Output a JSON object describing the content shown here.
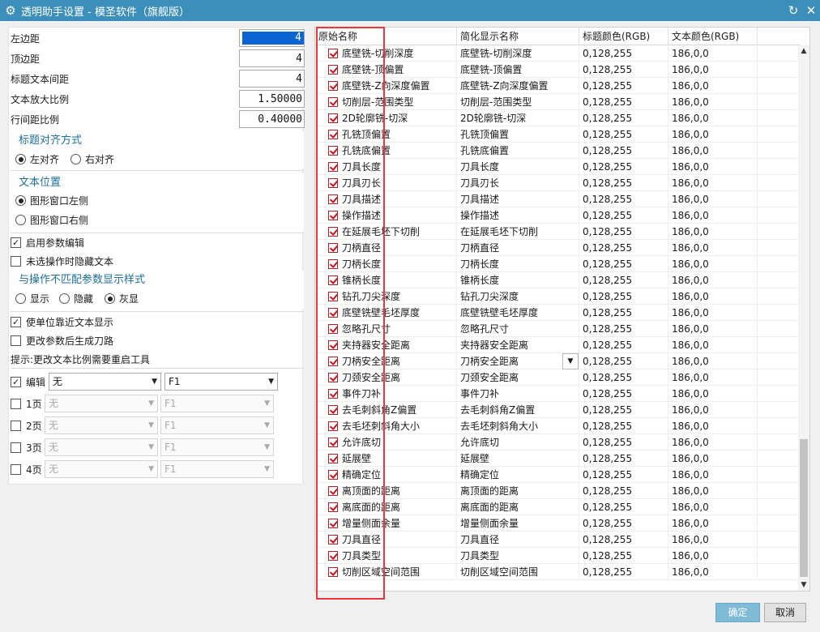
{
  "window": {
    "title": "透明助手设置 - 模圣软件（旗舰版）",
    "icon": "gear-icon"
  },
  "params": {
    "left_margin": {
      "label": "左边距",
      "value": "4"
    },
    "top_margin": {
      "label": "顶边距",
      "value": "4"
    },
    "title_text_spacing": {
      "label": "标题文本间距",
      "value": "4"
    },
    "text_scale": {
      "label": "文本放大比例",
      "value": "1.50000"
    },
    "line_spacing": {
      "label": "行间距比例",
      "value": "0.40000"
    }
  },
  "title_align": {
    "title": "标题对齐方式",
    "options": [
      "左对齐",
      "右对齐"
    ],
    "selected": "左对齐"
  },
  "text_position": {
    "title": "文本位置",
    "options": [
      "图形窗口左侧",
      "图形窗口右侧"
    ],
    "selected": "图形窗口左侧"
  },
  "checks": {
    "enable_param_edit": {
      "label": "启用参数编辑",
      "checked": true
    },
    "hide_text_unselected": {
      "label": "未选操作时隐藏文本",
      "checked": false
    },
    "unit_near_text": {
      "label": "使单位靠近文本显示",
      "checked": true
    },
    "regen_path_after_change": {
      "label": "更改参数后生成刀路",
      "checked": false
    }
  },
  "mismatch_style": {
    "title": "与操作不匹配参数显示样式",
    "options": [
      "显示",
      "隐藏",
      "灰显"
    ],
    "selected": "灰显"
  },
  "hint": "提示:更改文本比例需要重启工具",
  "pages": [
    {
      "label": "编辑",
      "checked": true,
      "opt1": "无",
      "opt2": "F1",
      "enabled": true
    },
    {
      "label": "1页",
      "checked": false,
      "opt1": "无",
      "opt2": "F1",
      "enabled": false
    },
    {
      "label": "2页",
      "checked": false,
      "opt1": "无",
      "opt2": "F1",
      "enabled": false
    },
    {
      "label": "3页",
      "checked": false,
      "opt1": "无",
      "opt2": "F1",
      "enabled": false
    },
    {
      "label": "4页",
      "checked": false,
      "opt1": "无",
      "opt2": "F1",
      "enabled": false
    }
  ],
  "table": {
    "headers": [
      "原始名称",
      "简化显示名称",
      "标题颜色(RGB)",
      "文本颜色(RGB)"
    ],
    "rows": [
      {
        "name": "底壁铣-切削深度",
        "short": "底壁铣-切削深度",
        "title_rgb": "0,128,255",
        "text_rgb": "186,0,0"
      },
      {
        "name": "底壁铣-顶偏置",
        "short": "底壁铣-顶偏置",
        "title_rgb": "0,128,255",
        "text_rgb": "186,0,0"
      },
      {
        "name": "底壁铣-Z向深度偏置",
        "short": "底壁铣-Z向深度偏置",
        "title_rgb": "0,128,255",
        "text_rgb": "186,0,0"
      },
      {
        "name": "切削层-范围类型",
        "short": "切削层-范围类型",
        "title_rgb": "0,128,255",
        "text_rgb": "186,0,0"
      },
      {
        "name": "2D轮廓铣-切深",
        "short": "2D轮廓铣-切深",
        "title_rgb": "0,128,255",
        "text_rgb": "186,0,0"
      },
      {
        "name": "孔铣顶偏置",
        "short": "孔铣顶偏置",
        "title_rgb": "0,128,255",
        "text_rgb": "186,0,0"
      },
      {
        "name": "孔铣底偏置",
        "short": "孔铣底偏置",
        "title_rgb": "0,128,255",
        "text_rgb": "186,0,0"
      },
      {
        "name": "刀具长度",
        "short": "刀具长度",
        "title_rgb": "0,128,255",
        "text_rgb": "186,0,0"
      },
      {
        "name": "刀具刃长",
        "short": "刀具刃长",
        "title_rgb": "0,128,255",
        "text_rgb": "186,0,0"
      },
      {
        "name": "刀具描述",
        "short": "刀具描述",
        "title_rgb": "0,128,255",
        "text_rgb": "186,0,0"
      },
      {
        "name": "操作描述",
        "short": "操作描述",
        "title_rgb": "0,128,255",
        "text_rgb": "186,0,0"
      },
      {
        "name": "在延展毛坯下切削",
        "short": "在延展毛坯下切削",
        "title_rgb": "0,128,255",
        "text_rgb": "186,0,0"
      },
      {
        "name": "刀柄直径",
        "short": "刀柄直径",
        "title_rgb": "0,128,255",
        "text_rgb": "186,0,0"
      },
      {
        "name": "刀柄长度",
        "short": "刀柄长度",
        "title_rgb": "0,128,255",
        "text_rgb": "186,0,0"
      },
      {
        "name": "锥柄长度",
        "short": "锥柄长度",
        "title_rgb": "0,128,255",
        "text_rgb": "186,0,0"
      },
      {
        "name": "钻孔刀尖深度",
        "short": "钻孔刀尖深度",
        "title_rgb": "0,128,255",
        "text_rgb": "186,0,0"
      },
      {
        "name": "底壁铣壁毛坯厚度",
        "short": "底壁铣壁毛坯厚度",
        "title_rgb": "0,128,255",
        "text_rgb": "186,0,0"
      },
      {
        "name": "忽略孔尺寸",
        "short": "忽略孔尺寸",
        "title_rgb": "0,128,255",
        "text_rgb": "186,0,0"
      },
      {
        "name": "夹持器安全距离",
        "short": "夹持器安全距离",
        "title_rgb": "0,128,255",
        "text_rgb": "186,0,0"
      },
      {
        "name": "刀柄安全距离",
        "short": "刀柄安全距离",
        "title_rgb": "0,128,255",
        "text_rgb": "186,0,0"
      },
      {
        "name": "刀颈安全距离",
        "short": "刀颈安全距离",
        "title_rgb": "0,128,255",
        "text_rgb": "186,0,0"
      },
      {
        "name": "事件刀补",
        "short": "事件刀补",
        "title_rgb": "0,128,255",
        "text_rgb": "186,0,0"
      },
      {
        "name": "去毛刺斜角Z偏置",
        "short": "去毛刺斜角Z偏置",
        "title_rgb": "0,128,255",
        "text_rgb": "186,0,0"
      },
      {
        "name": "去毛坯刺斜角大小",
        "short": "去毛坯刺斜角大小",
        "title_rgb": "0,128,255",
        "text_rgb": "186,0,0"
      },
      {
        "name": "允许底切",
        "short": "允许底切",
        "title_rgb": "0,128,255",
        "text_rgb": "186,0,0"
      },
      {
        "name": "延展壁",
        "short": "延展壁",
        "title_rgb": "0,128,255",
        "text_rgb": "186,0,0"
      },
      {
        "name": "精确定位",
        "short": "精确定位",
        "title_rgb": "0,128,255",
        "text_rgb": "186,0,0"
      },
      {
        "name": "离顶面的距离",
        "short": "离顶面的距离",
        "title_rgb": "0,128,255",
        "text_rgb": "186,0,0"
      },
      {
        "name": "离底面的距离",
        "short": "离底面的距离",
        "title_rgb": "0,128,255",
        "text_rgb": "186,0,0"
      },
      {
        "name": "增量侧面余量",
        "short": "增量侧面余量",
        "title_rgb": "0,128,255",
        "text_rgb": "186,0,0"
      },
      {
        "name": "刀具直径",
        "short": "刀具直径",
        "title_rgb": "0,128,255",
        "text_rgb": "186,0,0"
      },
      {
        "name": "刀具类型",
        "short": "刀具类型",
        "title_rgb": "0,128,255",
        "text_rgb": "186,0,0"
      },
      {
        "name": "切削区域空间范围",
        "short": "切削区域空间范围",
        "title_rgb": "0,128,255",
        "text_rgb": "186,0,0"
      }
    ],
    "editing_row_index": 19
  },
  "buttons": {
    "ok": "确定",
    "cancel": "取消"
  },
  "colors": {
    "titlebar": "#3c8fba",
    "accent_text": "#1e6f9a",
    "highlight": "#e8383d",
    "ok_button": "#7fbad6"
  }
}
